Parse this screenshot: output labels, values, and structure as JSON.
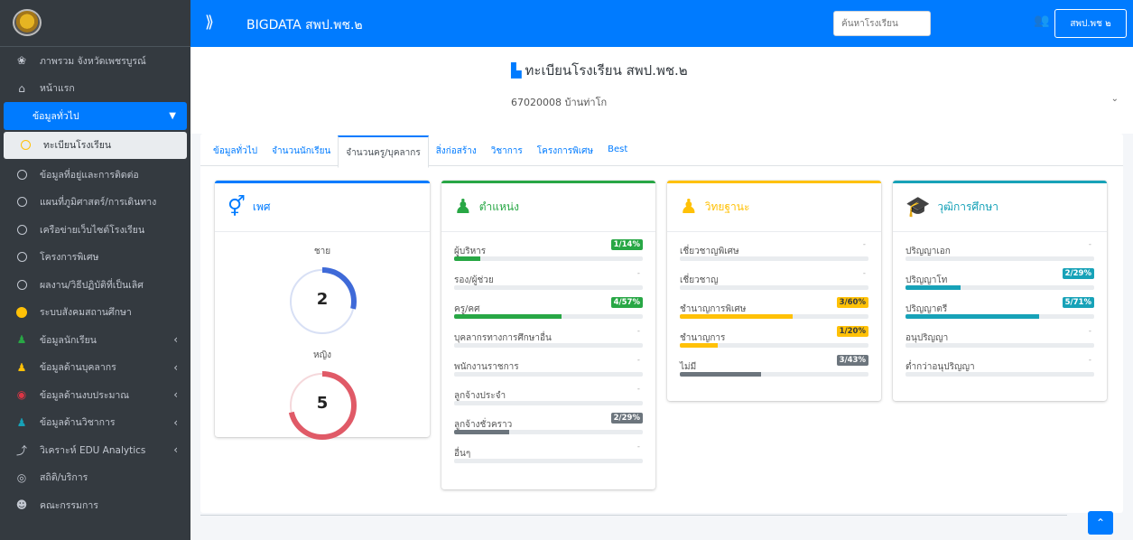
{
  "header": {
    "title": "BIGDATA สพป.พช.๒",
    "search_placeholder": "ค้นหาโรงเรียน",
    "user_label": "สพป.พช ๒"
  },
  "sidebar": {
    "items": [
      {
        "label": "ภาพรวม จังหวัดเพชรบูรณ์",
        "icon": "dashboard-icon"
      },
      {
        "label": "หน้าแรก",
        "icon": "home-icon"
      },
      {
        "label": "ข้อมูลทั่วไป",
        "icon": "none"
      },
      {
        "label": "ทะเบียนโรงเรียน",
        "icon": "circle-icon"
      },
      {
        "label": "ข้อมูลที่อยู่และการติดต่อ",
        "icon": "circle-icon"
      },
      {
        "label": "แผนที่ภูมิศาสตร์/การเดินทาง",
        "icon": "circle-icon"
      },
      {
        "label": "เครือข่ายเว็บไซต์โรงเรียน",
        "icon": "circle-icon"
      },
      {
        "label": "โครงการพิเศษ",
        "icon": "circle-icon"
      },
      {
        "label": "ผลงาน/วิธีปฏิบัติที่เป็นเลิศ",
        "icon": "circle-icon"
      },
      {
        "label": "ระบบสังคมสถานศึกษา",
        "icon": "yellow-dot-icon"
      },
      {
        "label": "ข้อมูลนักเรียน",
        "icon": "student-icon"
      },
      {
        "label": "ข้อมูลด้านบุคลากร",
        "icon": "staff-icon"
      },
      {
        "label": "ข้อมูลด้านงบประมาณ",
        "icon": "budget-icon"
      },
      {
        "label": "ข้อมูลด้านวิชาการ",
        "icon": "academic-icon"
      },
      {
        "label": "วิเคราะห์ EDU Analytics",
        "icon": "chart-icon"
      },
      {
        "label": "สถิติ/บริการ",
        "icon": "stats-icon"
      },
      {
        "label": "คณะกรรมการ",
        "icon": "committee-icon"
      }
    ]
  },
  "school": {
    "title": "ทะเบียนโรงเรียน สพป.พช.๒",
    "selected": "67020008 บ้านท่าโก"
  },
  "tabs": [
    {
      "label": "ข้อมูลทั่วไป"
    },
    {
      "label": "จำนวนนักเรียน"
    },
    {
      "label": "จำนวนครู/บุคลากร"
    },
    {
      "label": "สิ่งก่อสร้าง"
    },
    {
      "label": "วิชาการ"
    },
    {
      "label": "โครงการพิเศษ"
    },
    {
      "label": "Best"
    }
  ],
  "cards": {
    "sex": {
      "title": "เพศ",
      "male_label": "ชาย",
      "male_value": "2",
      "female_label": "หญิง",
      "female_value": "5",
      "male_fraction": 0.286,
      "female_fraction": 0.714,
      "male_color": "#3f6ad8",
      "female_color": "#e05a67"
    },
    "position": {
      "title": "ตำแหน่ง",
      "rows": [
        {
          "label": "ผู้บริหาร",
          "value": "1/14%",
          "pct": 14,
          "color": "#28a745"
        },
        {
          "label": "รอง/ผู้ช่วย",
          "value": "-",
          "pct": 0,
          "color": "#28a745"
        },
        {
          "label": "ครู/คศ",
          "value": "4/57%",
          "pct": 57,
          "color": "#28a745"
        },
        {
          "label": "บุคลากรทางการศึกษาอื่น",
          "value": "-",
          "pct": 0,
          "color": "#28a745"
        },
        {
          "label": "พนักงานราชการ",
          "value": "-",
          "pct": 0,
          "color": "#28a745"
        },
        {
          "label": "ลูกจ้างประจำ",
          "value": "-",
          "pct": 0,
          "color": "#28a745"
        },
        {
          "label": "ลูกจ้างชั่วคราว",
          "value": "2/29%",
          "pct": 29,
          "color": "#6c757d"
        },
        {
          "label": "อื่นๆ",
          "value": "-",
          "pct": 0,
          "color": "#6c757d"
        }
      ]
    },
    "rank": {
      "title": "วิทยฐานะ",
      "rows": [
        {
          "label": "เชี่ยวชาญพิเศษ",
          "value": "-",
          "pct": 0,
          "color": "#ffc107"
        },
        {
          "label": "เชี่ยวชาญ",
          "value": "-",
          "pct": 0,
          "color": "#ffc107"
        },
        {
          "label": "ชำนาญการพิเศษ",
          "value": "3/60%",
          "pct": 60,
          "color": "#ffc107"
        },
        {
          "label": "ชำนาญการ",
          "value": "1/20%",
          "pct": 20,
          "color": "#ffc107"
        },
        {
          "label": "ไม่มี",
          "value": "3/43%",
          "pct": 43,
          "color": "#6c757d"
        }
      ]
    },
    "education": {
      "title": "วุฒิการศึกษา",
      "rows": [
        {
          "label": "ปริญญาเอก",
          "value": "-",
          "pct": 0,
          "color": "#17a2b8"
        },
        {
          "label": "ปริญญาโท",
          "value": "2/29%",
          "pct": 29,
          "color": "#17a2b8"
        },
        {
          "label": "ปริญญาตรี",
          "value": "5/71%",
          "pct": 71,
          "color": "#17a2b8"
        },
        {
          "label": "อนุปริญญา",
          "value": "-",
          "pct": 0,
          "color": "#17a2b8"
        },
        {
          "label": "ต่ำกว่าอนุปริญญา",
          "value": "-",
          "pct": 0,
          "color": "#17a2b8"
        }
      ]
    }
  }
}
